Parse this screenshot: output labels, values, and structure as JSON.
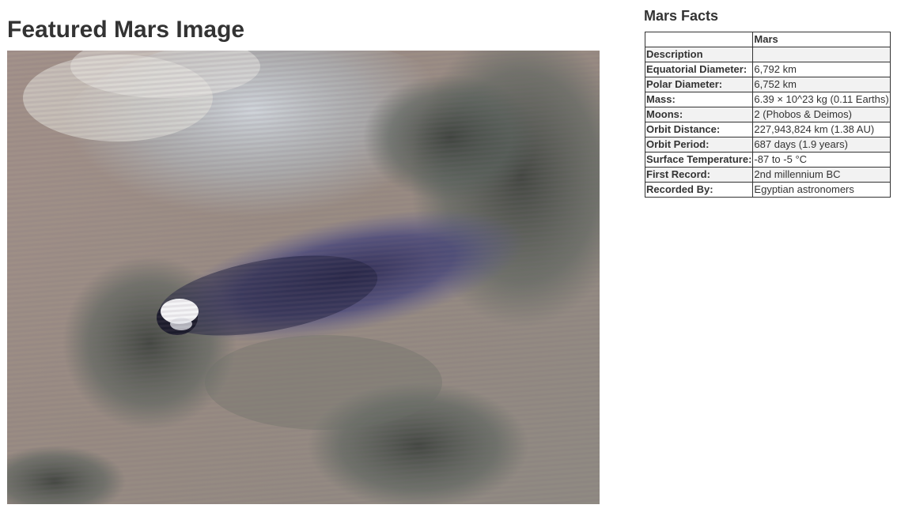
{
  "featured": {
    "title": "Featured Mars Image"
  },
  "facts": {
    "title": "Mars Facts",
    "header": [
      "",
      "Mars"
    ],
    "rows": [
      {
        "label": "Description",
        "value": ""
      },
      {
        "label": "Equatorial Diameter:",
        "value": "6,792 km"
      },
      {
        "label": "Polar Diameter:",
        "value": "6,752 km"
      },
      {
        "label": "Mass:",
        "value": "6.39 × 10^23 kg (0.11 Earths)"
      },
      {
        "label": "Moons:",
        "value": "2 (Phobos & Deimos)"
      },
      {
        "label": "Orbit Distance:",
        "value": "227,943,824 km (1.38 AU)"
      },
      {
        "label": "Orbit Period:",
        "value": "687 days (1.9 years)"
      },
      {
        "label": "Surface Temperature:",
        "value": "-87 to -5 °C"
      },
      {
        "label": "First Record:",
        "value": "2nd millennium BC"
      },
      {
        "label": "Recorded By:",
        "value": "Egyptian astronomers"
      }
    ]
  }
}
